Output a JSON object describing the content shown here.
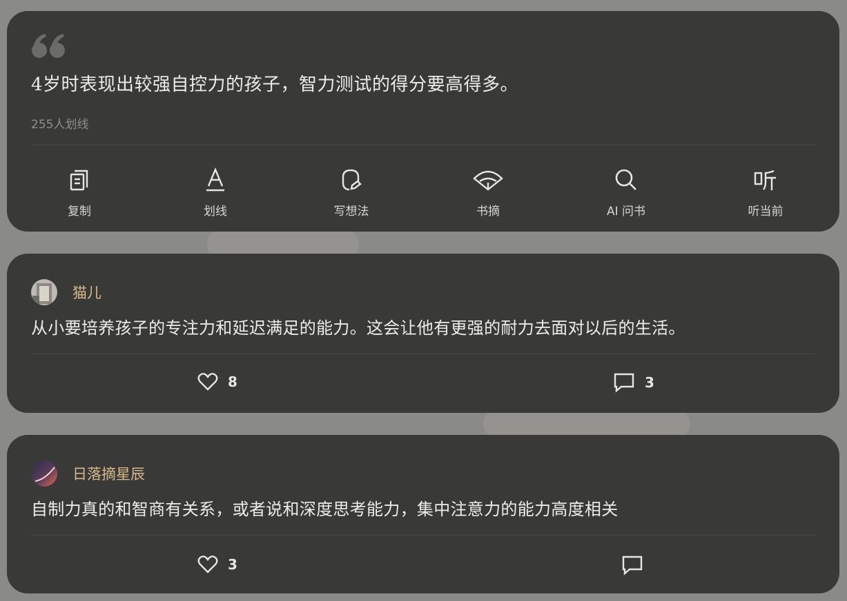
{
  "highlight": {
    "quote": "4岁时表现出较强自控力的孩子，智力测试的得分要高得多。",
    "marked_count": "255人划线"
  },
  "actions": [
    {
      "label": "复制",
      "icon": "copy-icon"
    },
    {
      "label": "划线",
      "icon": "underline-icon"
    },
    {
      "label": "写想法",
      "icon": "thought-icon"
    },
    {
      "label": "书摘",
      "icon": "fan-icon"
    },
    {
      "label": "AI 问书",
      "icon": "search-icon"
    },
    {
      "label": "听当前",
      "icon": "listen-icon"
    }
  ],
  "comments": [
    {
      "user": "猫儿",
      "text": "从小要培养孩子的专注力和延迟满足的能力。这会让他有更强的耐力去面对以后的生活。",
      "likes": "8",
      "replies": "3"
    },
    {
      "user": "日落摘星辰",
      "text": "自制力真的和智商有关系，或者说和深度思考能力，集中注意力的能力高度相关",
      "likes": "3",
      "replies": ""
    }
  ],
  "colors": {
    "card": "#393a37",
    "username": "#d9b88b",
    "text": "#ecece9"
  }
}
